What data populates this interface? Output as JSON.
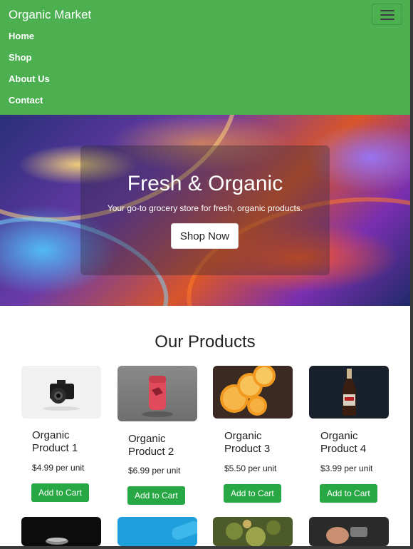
{
  "navbar": {
    "brand": "Organic Market",
    "items": [
      {
        "label": "Home"
      },
      {
        "label": "Shop"
      },
      {
        "label": "About Us"
      },
      {
        "label": "Contact"
      }
    ],
    "bg_color": "#4caf50"
  },
  "hero": {
    "title": "Fresh & Organic",
    "subtitle": "Your go-to grocery store for fresh, organic products.",
    "button_label": "Shop Now"
  },
  "products": {
    "title": "Our Products",
    "items": [
      {
        "name": "Organic Product 1",
        "price": "$4.99 per unit",
        "button": "Add to Cart",
        "image": "camera-photo"
      },
      {
        "name": "Organic Product 2",
        "price": "$6.99 per unit",
        "button": "Add to Cart",
        "image": "red-lighter-photo"
      },
      {
        "name": "Organic Product 3",
        "price": "$5.50 per unit",
        "button": "Add to Cart",
        "image": "orange-slices-photo"
      },
      {
        "name": "Organic Product 4",
        "price": "$3.99 per unit",
        "button": "Add to Cart",
        "image": "bottle-photo"
      },
      {
        "image": "dark-object-photo"
      },
      {
        "image": "blue-object-photo"
      },
      {
        "image": "plant-photo"
      },
      {
        "image": "hand-watch-photo"
      }
    ],
    "button_color": "#28a745"
  }
}
